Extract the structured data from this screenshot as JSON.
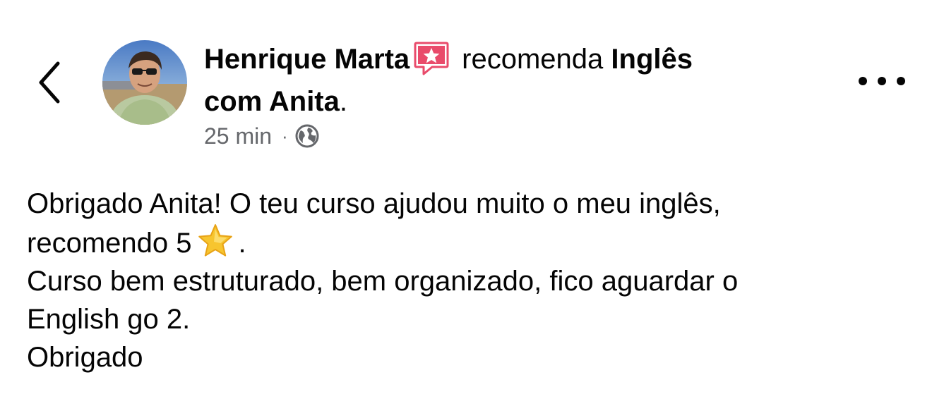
{
  "header": {
    "author_name": "Henrique Marta",
    "recommends_word": "recomenda",
    "page_name_line1": "Inglês",
    "page_name_line2": "com Anita",
    "period": "."
  },
  "meta": {
    "time": "25 min",
    "separator": "·",
    "audience_icon": "globe-icon"
  },
  "post": {
    "line1": "Obrigado Anita! O teu curso ajudou muito o meu inglês,",
    "line2_text": "recomendo 5",
    "line2_emoji": "star-emoji",
    "line2_end": ".",
    "line3": "Curso bem estruturado, bem organizado, fico aguardar o",
    "line4": "English go 2.",
    "line5": "Obrigado"
  },
  "icons": {
    "back": "chevron-left-icon",
    "recommend_badge": "recommend-star-icon",
    "more": "more-options-icon"
  },
  "colors": {
    "text": "#050505",
    "meta": "#65676b",
    "recommend_badge": "#e94b6b",
    "star": "#f7c52f"
  }
}
